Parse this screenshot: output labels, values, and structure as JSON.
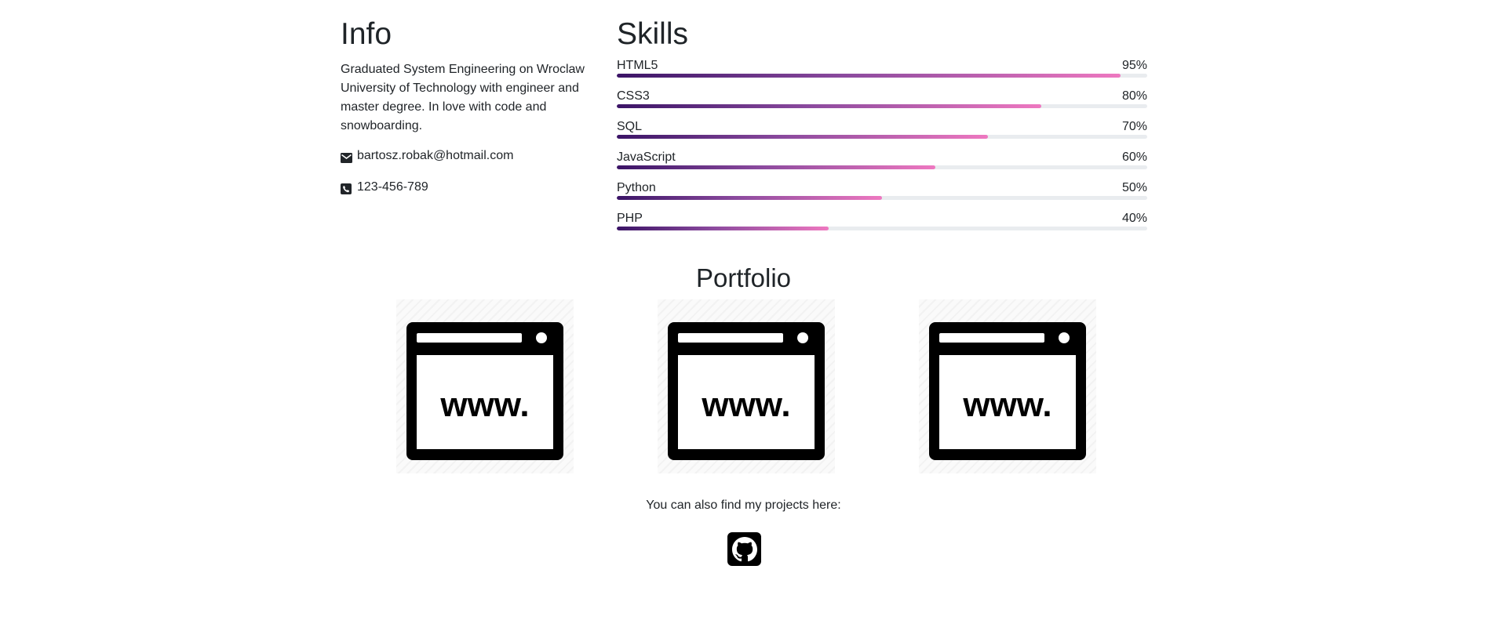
{
  "info": {
    "title": "Info",
    "description": "Graduated System Engineering on Wroclaw University of Technology with engineer and master degree. In love with code and snowboarding.",
    "email": "bartosz.robak@hotmail.com",
    "phone": "123-456-789",
    "email_icon": "envelope-icon",
    "phone_icon": "phone-icon"
  },
  "skills": {
    "title": "Skills",
    "items": [
      {
        "name": "HTML5",
        "percent_label": "95%",
        "value": 95
      },
      {
        "name": "CSS3",
        "percent_label": "80%",
        "value": 80
      },
      {
        "name": "SQL",
        "percent_label": "70%",
        "value": 70
      },
      {
        "name": "JavaScript",
        "percent_label": "60%",
        "value": 60
      },
      {
        "name": "Python",
        "percent_label": "50%",
        "value": 50
      },
      {
        "name": "PHP",
        "percent_label": "40%",
        "value": 40
      }
    ],
    "bar_gradient": [
      "#3b1466",
      "#8b4a9e",
      "#ee78c0"
    ],
    "track_color": "#e9ecef"
  },
  "portfolio": {
    "title": "Portfolio",
    "tiles": [
      {
        "icon": "browser-www-icon",
        "text": "www."
      },
      {
        "icon": "browser-www-icon",
        "text": "www."
      },
      {
        "icon": "browser-www-icon",
        "text": "www."
      }
    ],
    "also_text": "You can also find my projects here:",
    "github_icon": "github-icon"
  }
}
